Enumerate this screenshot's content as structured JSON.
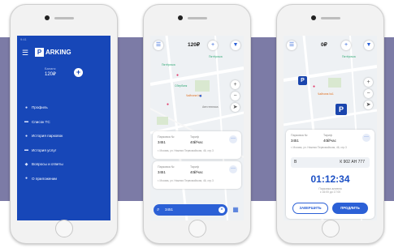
{
  "menu_phone": {
    "status_text": "9:41",
    "logo_letter": "P",
    "logo_text": "ARKING",
    "balance_label": "Баланс",
    "balance_value": "120₽",
    "menu_items": [
      {
        "icon": "user-icon",
        "glyph": "●",
        "label": "Профиль"
      },
      {
        "icon": "car-icon",
        "glyph": "▬",
        "label": "Список ТС"
      },
      {
        "icon": "history-icon",
        "glyph": "●",
        "label": "История парковок"
      },
      {
        "icon": "payments-icon",
        "glyph": "▬",
        "label": "История услуг"
      },
      {
        "icon": "help-icon",
        "glyph": "◆",
        "label": "Вопросы и ответы"
      },
      {
        "icon": "info-icon",
        "glyph": "●",
        "label": "О приложении"
      }
    ]
  },
  "list_phone": {
    "balance": "120₽",
    "map_labels": [
      "Пятёрочка",
      "Пятёрочка",
      "Сбербанк",
      "Чайхона №1",
      "Автотехника"
    ],
    "cards": [
      {
        "zone_label": "Парковка №",
        "zone": "3451",
        "tariff_label": "Тариф",
        "tariff": "40₽/час",
        "address": "г. Москва, ул. Нижняя Первомайская, 46, стр.3"
      },
      {
        "zone_label": "Парковка №",
        "zone": "3451",
        "tariff_label": "Тариф",
        "tariff": "40₽/час",
        "address": "г. Москва, ул. Нижняя Первомайская, 46, стр.3"
      }
    ],
    "search_value": "3451"
  },
  "session_phone": {
    "balance": "0₽",
    "map_labels": [
      "Пятёрочка",
      "Чайхона №1"
    ],
    "zone_label": "Парковка №",
    "zone": "3451",
    "tariff_label": "Тариф",
    "tariff": "40₽/час",
    "address": "г. Москва, ул. Нижняя Первомайская, 46, стр.3",
    "plate_label": "В",
    "plate": "К 902 АН 777",
    "timer": "01:12:34",
    "timer_sub": "Парковка активна\nс 16:00 до 17:00",
    "end_button": "ЗАВЕРШИТЬ",
    "extend_button": "ПРОДЛИТЬ"
  },
  "colors": {
    "band": "#7c7ba6",
    "primary": "#2b60d6",
    "menu_bg": "#1747b8"
  }
}
